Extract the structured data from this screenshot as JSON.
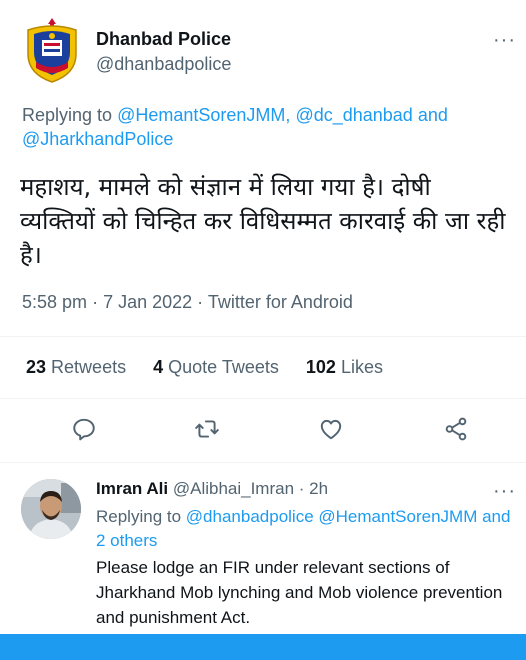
{
  "tweet": {
    "author_name": "Dhanbad Police",
    "author_handle": "@dhanbadpolice",
    "replying_prefix": "Replying to",
    "replying_mention1": "@HemantSorenJMM",
    "replying_sep": ",",
    "replying_mention2": "@dc_dhanbad",
    "replying_and": "and",
    "replying_mention3": "@JharkhandPolice",
    "text": "महाशय, मामले को संज्ञान में लिया गया है। दोषी व्यक्तियों को चिन्हित कर विधिसम्मत कारवाई की जा रही है।",
    "time": "5:58 pm",
    "date": "7 Jan 2022",
    "source": "Twitter for Android",
    "more_glyph": "···"
  },
  "stats": {
    "retweets_count": "23",
    "retweets_label": "Retweets",
    "quotes_count": "4",
    "quotes_label": "Quote Tweets",
    "likes_count": "102",
    "likes_label": "Likes"
  },
  "actions": {
    "icons": [
      "reply-icon",
      "retweet-icon",
      "like-icon",
      "share-icon"
    ]
  },
  "reply": {
    "author_name": "Imran Ali",
    "author_handle": "@Alibhai_Imran",
    "time": "2h",
    "replying_prefix": "Replying to",
    "mention1": "@dhanbadpolice",
    "mention2": "@HemantSorenJMM",
    "and_others": "and 2 others",
    "text": "Please lodge an FIR under relevant sections of Jharkhand Mob lynching and Mob violence prevention and punishment Act.",
    "more_glyph": "···"
  },
  "colors": {
    "link": "#1d9bf0",
    "secondary_text": "#536471",
    "primary_text": "#0f1419",
    "divider": "#eff3f4"
  }
}
